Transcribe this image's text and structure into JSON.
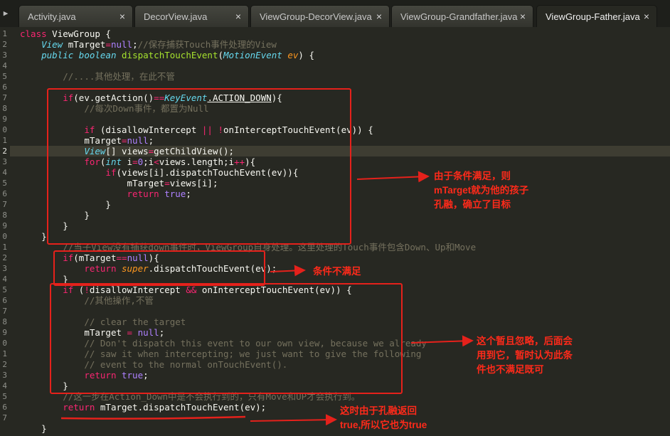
{
  "tabs": [
    {
      "label": "Activity.java",
      "close": "×"
    },
    {
      "label": "DecorView.java",
      "close": "×"
    },
    {
      "label": "ViewGroup-DecorView.java",
      "close": "×"
    },
    {
      "label": "ViewGroup-Grandfather.java",
      "close": "×"
    },
    {
      "label": "ViewGroup-Father.java",
      "close": "×",
      "active": true
    }
  ],
  "sidebar_toggle": "▶",
  "gutter_numbers": [
    "1",
    "2",
    "3",
    "4",
    "5",
    "6",
    "7",
    "8",
    "9",
    "0",
    "1",
    "2",
    "3",
    "4",
    "5",
    "6",
    "7",
    "8",
    "9",
    "0",
    "1",
    "2",
    "3",
    "4",
    "5",
    "6",
    "7",
    "8",
    "9",
    "0",
    "1",
    "2",
    "3",
    "4",
    "5",
    "6",
    "7"
  ],
  "code": {
    "l1": {
      "a": "class",
      "b": " ViewGroup {"
    },
    "l2": {
      "a": "View",
      "b": " mTarget",
      "c": "=",
      "d": "null",
      "e": ";",
      "f": "//保存捕获Touch事件处理的View"
    },
    "l3": {
      "a": "public",
      "b": "boolean",
      "c": "dispatchTouchEvent",
      "d": "MotionEvent",
      "e": "ev",
      "f": ") {"
    },
    "l5": {
      "a": "//....其他处理，在此不管"
    },
    "l7": {
      "a": "if",
      "b": "(ev.getAction()",
      "c": "==",
      "d": "KeyEvent",
      "e": ".ACTION_DOWN",
      "f": "){"
    },
    "l8": {
      "a": "//每次Down事件，都置为Null"
    },
    "l10": {
      "a": "if",
      "b": " (disallowIntercept ",
      "c": "||",
      "d": " !",
      "e": "onInterceptTouchEvent(ev)) {"
    },
    "l11": {
      "a": "mTarget",
      "b": "=",
      "c": "null",
      "d": ";"
    },
    "l12": {
      "a": "View",
      "b": "[] views",
      "c": "=",
      "d": "getChildView();"
    },
    "l13": {
      "a": "for",
      "b": "(",
      "c": "int",
      "d": " i",
      "e": "=",
      "f": "0",
      "g": ";i",
      "h": "<",
      "i": "views.length;i",
      "j": "++",
      "k": "){"
    },
    "l14": {
      "a": "if",
      "b": "(views[i].dispatchTouchEvent(ev)){"
    },
    "l15": {
      "a": "mTarget",
      "b": "=",
      "c": "views[i];"
    },
    "l16": {
      "a": "return",
      "b": "true",
      "c": ";"
    },
    "l17": {
      "a": "}"
    },
    "l18": {
      "a": "}"
    },
    "l19": {
      "a": "}"
    },
    "l20": {
      "a": "}"
    },
    "l21": {
      "a": "//当子View没有捕获down事件时，ViewGroup自身处理。这里处理的Touch事件包含Down、Up和Move"
    },
    "l22": {
      "a": "if",
      "b": "(mTarget",
      "c": "==",
      "d": "null",
      "e": "){"
    },
    "l23": {
      "a": "return",
      "b": "super",
      "c": ".dispatchTouchEvent(ev);"
    },
    "l24": {
      "a": "}"
    },
    "l25": {
      "a": "if",
      "b": " (",
      "c": "!",
      "d": "disallowIntercept ",
      "e": "&&",
      "f": " onInterceptTouchEvent(ev)) {"
    },
    "l26": {
      "a": "//其他操作,不管"
    },
    "l28": {
      "a": "// clear the target"
    },
    "l29": {
      "a": "mTarget",
      "b": " = ",
      "c": "null",
      "d": ";"
    },
    "l30": {
      "a": "// Don't dispatch this event to our own view, because we already"
    },
    "l31": {
      "a": "// saw it when intercepting; we just want to give the following"
    },
    "l32": {
      "a": "// event to the normal onTouchEvent()."
    },
    "l33": {
      "a": "return",
      "b": "true",
      "c": ";"
    },
    "l34": {
      "a": "}"
    },
    "l35": {
      "a": "//这一步在Action_Down中是不会执行到的，只有Move和UP才会执行到。"
    },
    "l36": {
      "a": "return",
      "b": " mTarget.dispatchTouchEvent(ev);"
    },
    "l38": {
      "a": "}"
    }
  },
  "annotations": {
    "n1": "由于条件满足，则\nmTarget就为他的孩子\n孔融，确立了目标",
    "n2": "条件不满足",
    "n3": "这个暂且忽略，后面会\n用到它，暂时认为此条\n件也不满足既可",
    "n4": "这时由于孔融返回\ntrue,所以它也为true"
  },
  "colors": {
    "background": "#272822",
    "annotation": "#e5211b",
    "keyword": "#f92672",
    "function": "#a6e22e",
    "type": "#66d9ef",
    "comment": "#75715e",
    "number": "#ae81ff"
  }
}
